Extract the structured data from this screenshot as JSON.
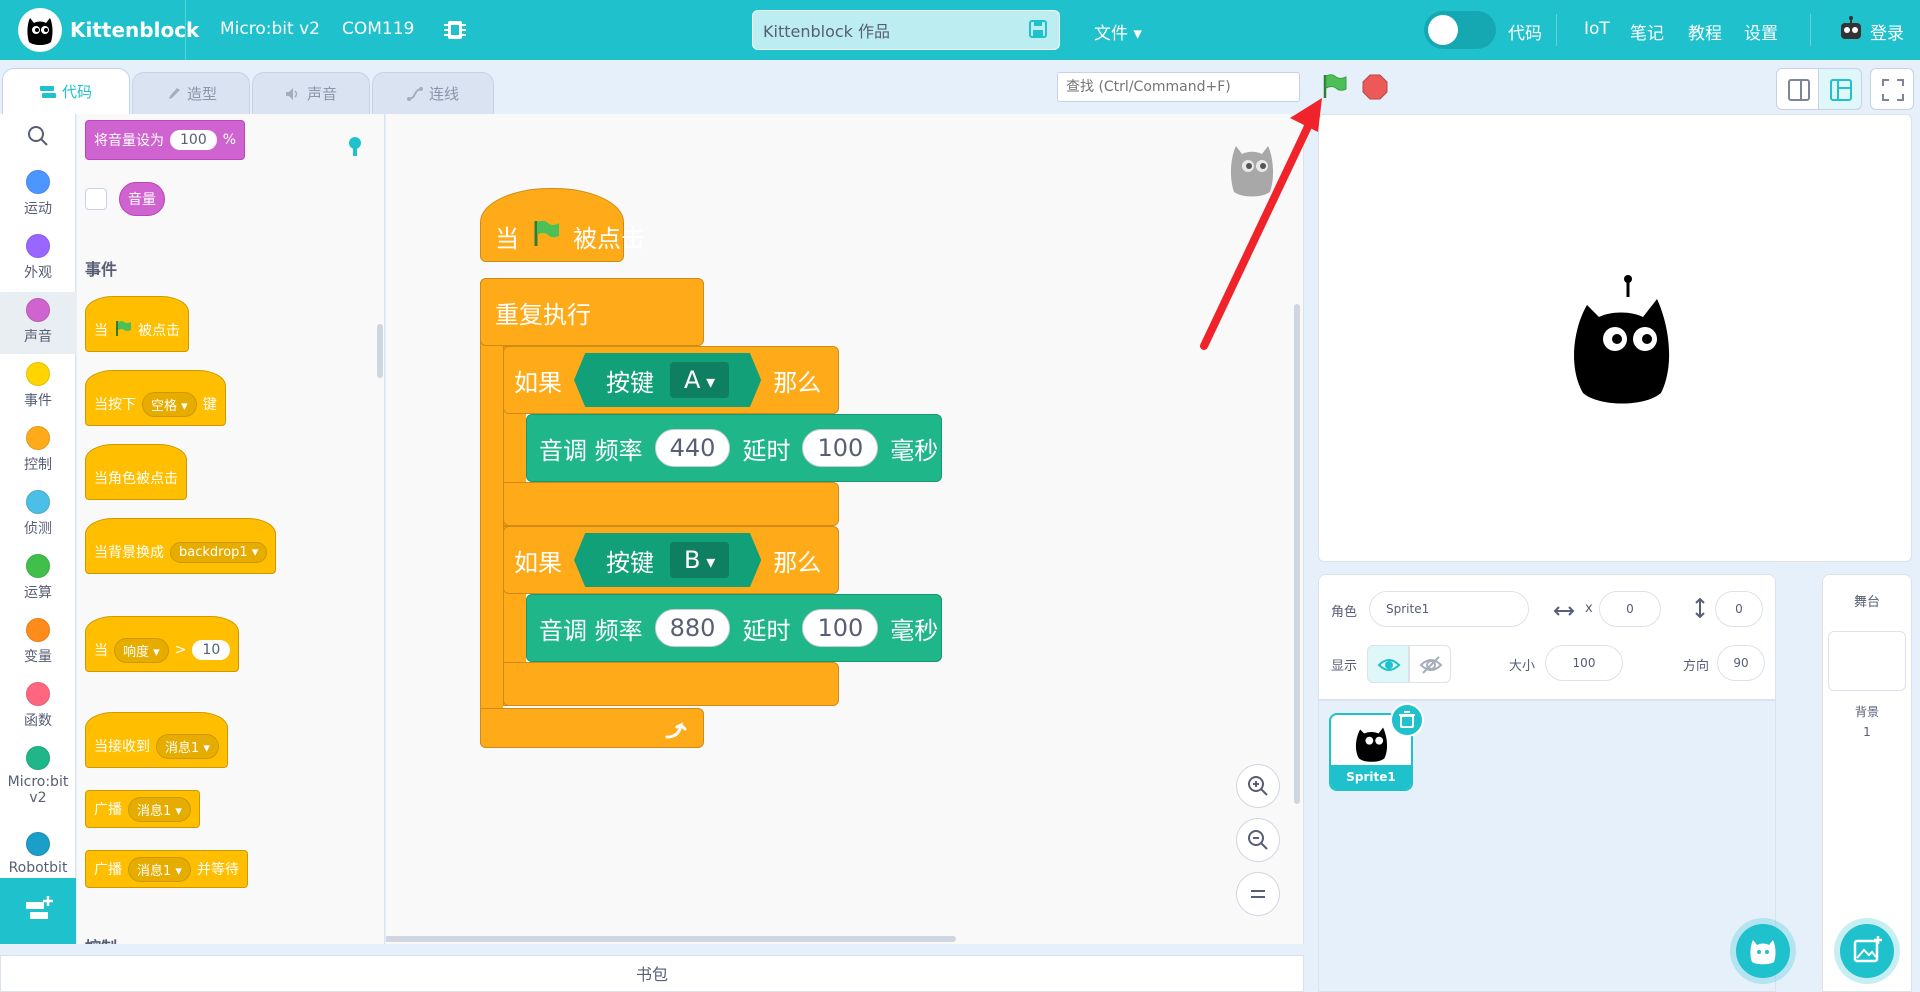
{
  "header": {
    "app_name": "Kittenblock",
    "device": "Micro:bit v2",
    "port": "COM119",
    "project_title": "Kittenblock 作品",
    "file_menu": "文件",
    "code_toggle_label": "代码",
    "nav": [
      "IoT",
      "笔记",
      "教程",
      "设置"
    ],
    "login": "登录",
    "accent_color": "#1ec1cc"
  },
  "tabs": [
    {
      "label": "代码",
      "active": true
    },
    {
      "label": "造型",
      "active": false
    },
    {
      "label": "声音",
      "active": false
    },
    {
      "label": "连线",
      "active": false
    }
  ],
  "search": {
    "placeholder": "查找 (Ctrl/Command+F)"
  },
  "categories": [
    {
      "label": "运动",
      "color": "#4c97ff"
    },
    {
      "label": "外观",
      "color": "#9966ff"
    },
    {
      "label": "声音",
      "color": "#cf63cf",
      "selected": true
    },
    {
      "label": "事件",
      "color": "#ffd500"
    },
    {
      "label": "控制",
      "color": "#ffab19"
    },
    {
      "label": "侦测",
      "color": "#4cbfe6"
    },
    {
      "label": "运算",
      "color": "#40bf4a"
    },
    {
      "label": "变量",
      "color": "#ff8c1a"
    },
    {
      "label": "函数",
      "color": "#ff6680"
    },
    {
      "label": "Micro:bit v2",
      "color": "#1fb68a"
    },
    {
      "label": "Robotbit",
      "color": "#1a9fc9"
    }
  ],
  "flyout": {
    "set_volume": {
      "label": "将音量设为",
      "value": "100",
      "unit": "%"
    },
    "volume_reporter": "音量",
    "events_heading": "事件",
    "when_flag": {
      "pre": "当",
      "post": "被点击"
    },
    "when_key": {
      "pre": "当按下",
      "key": "空格",
      "post": "键"
    },
    "when_sprite_clicked": "当角色被点击",
    "when_backdrop": {
      "label": "当背景换成",
      "value": "backdrop1"
    },
    "when_gt": {
      "pre": "当",
      "sensor": "响度",
      "op": ">",
      "value": "10"
    },
    "when_receive": {
      "label": "当接收到",
      "value": "消息1"
    },
    "broadcast": {
      "label": "广播",
      "value": "消息1"
    },
    "broadcast_wait": {
      "label": "广播",
      "value": "消息1",
      "post": "并等待"
    },
    "control_heading": "控制"
  },
  "script": {
    "hat": {
      "pre": "当",
      "post": "被点击"
    },
    "forever": "重复执行",
    "if1": {
      "if": "如果",
      "key_label": "按键",
      "key": "A",
      "then": "那么"
    },
    "tone1": {
      "label": "音调 频率",
      "freq": "440",
      "delay_label": "延时",
      "delay": "100",
      "unit": "毫秒"
    },
    "if2": {
      "if": "如果",
      "key_label": "按键",
      "key": "B",
      "then": "那么"
    },
    "tone2": {
      "label": "音调 频率",
      "freq": "880",
      "delay_label": "延时",
      "delay": "100",
      "unit": "毫秒"
    }
  },
  "backpack": "书包",
  "sprite_info": {
    "sprite_label": "角色",
    "sprite_name": "Sprite1",
    "x_label": "x",
    "x": "0",
    "y_label": "y",
    "y": "0",
    "show_label": "显示",
    "size_label": "大小",
    "size": "100",
    "direction_label": "方向",
    "direction": "90"
  },
  "sprites": [
    {
      "name": "Sprite1"
    }
  ],
  "stage_pane": {
    "title": "舞台",
    "backdrop_label": "背景",
    "backdrop_count": "1"
  },
  "icons": [
    "search-icon",
    "green-flag-icon",
    "stop-icon",
    "save-icon",
    "chip-icon",
    "zoom-in-icon",
    "zoom-out-icon",
    "zoom-reset-icon",
    "eye-icon",
    "eye-slash-icon",
    "trash-icon",
    "cat-add-icon",
    "image-add-icon",
    "extension-icon"
  ]
}
